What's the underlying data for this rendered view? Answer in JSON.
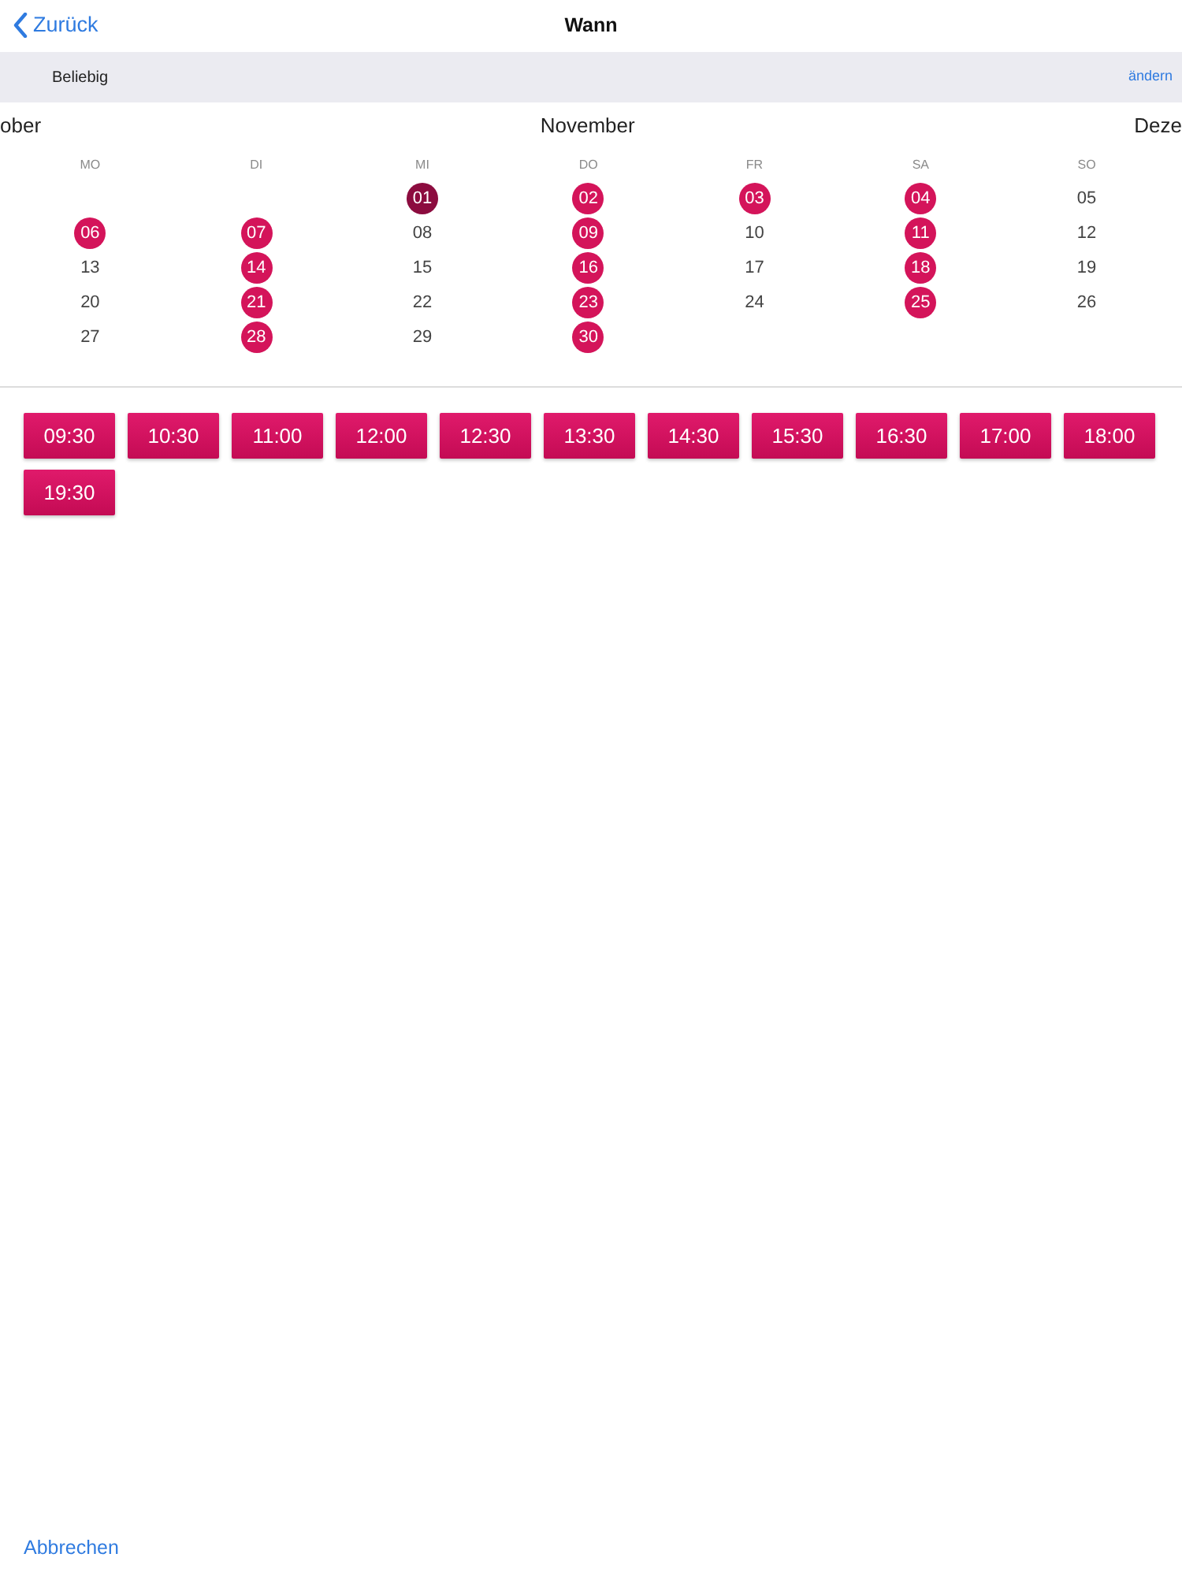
{
  "nav": {
    "back": "Zurück",
    "title": "Wann"
  },
  "filter": {
    "label": "Beliebig",
    "action": "ändern"
  },
  "calendar": {
    "prev_month": "ober",
    "month": "November",
    "next_month": "Deze",
    "weekdays": [
      "MO",
      "DI",
      "MI",
      "DO",
      "FR",
      "SA",
      "SO"
    ],
    "weeks": [
      [
        {
          "day": "01",
          "available": true,
          "selected": true
        },
        {
          "day": "02",
          "available": true,
          "selected": false
        },
        {
          "day": "03",
          "available": true,
          "selected": false
        },
        {
          "day": "04",
          "available": true,
          "selected": false
        },
        {
          "day": "05",
          "available": false,
          "selected": false
        }
      ],
      [
        {
          "day": "06",
          "available": true,
          "selected": false
        },
        {
          "day": "07",
          "available": true,
          "selected": false
        },
        {
          "day": "08",
          "available": false,
          "selected": false
        },
        {
          "day": "09",
          "available": true,
          "selected": false
        },
        {
          "day": "10",
          "available": false,
          "selected": false
        },
        {
          "day": "11",
          "available": true,
          "selected": false
        },
        {
          "day": "12",
          "available": false,
          "selected": false
        }
      ],
      [
        {
          "day": "13",
          "available": false,
          "selected": false
        },
        {
          "day": "14",
          "available": true,
          "selected": false
        },
        {
          "day": "15",
          "available": false,
          "selected": false
        },
        {
          "day": "16",
          "available": true,
          "selected": false
        },
        {
          "day": "17",
          "available": false,
          "selected": false
        },
        {
          "day": "18",
          "available": true,
          "selected": false
        },
        {
          "day": "19",
          "available": false,
          "selected": false
        }
      ],
      [
        {
          "day": "20",
          "available": false,
          "selected": false
        },
        {
          "day": "21",
          "available": true,
          "selected": false
        },
        {
          "day": "22",
          "available": false,
          "selected": false
        },
        {
          "day": "23",
          "available": true,
          "selected": false
        },
        {
          "day": "24",
          "available": false,
          "selected": false
        },
        {
          "day": "25",
          "available": true,
          "selected": false
        },
        {
          "day": "26",
          "available": false,
          "selected": false
        }
      ],
      [
        {
          "day": "27",
          "available": false,
          "selected": false
        },
        {
          "day": "28",
          "available": true,
          "selected": false
        },
        {
          "day": "29",
          "available": false,
          "selected": false
        },
        {
          "day": "30",
          "available": true,
          "selected": false
        }
      ]
    ]
  },
  "times": [
    "09:30",
    "10:30",
    "11:00",
    "12:00",
    "12:30",
    "13:30",
    "14:30",
    "15:30",
    "16:30",
    "17:00",
    "18:00",
    "19:30"
  ],
  "cancel": "Abbrechen"
}
